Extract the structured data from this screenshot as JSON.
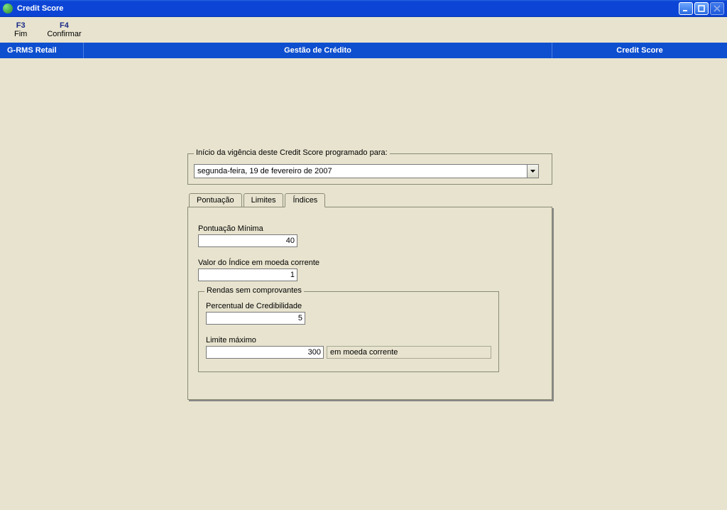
{
  "window": {
    "title": "Credit Score"
  },
  "fnbar": {
    "f3_key": "F3",
    "f3_label": "Fim",
    "f4_key": "F4",
    "f4_label": "Confirmar"
  },
  "modulebar": {
    "left": "G-RMS Retail",
    "mid": "Gestão de Crédito",
    "right": "Credit Score"
  },
  "date_group": {
    "legend": "Início da vigência deste Credit Score programado para:",
    "value": "segunda-feira, 19 de  fevereiro  de 2007"
  },
  "tabs": {
    "pontuacao": "Pontuação",
    "limites": "Limites",
    "indices": "Índices"
  },
  "indices": {
    "pont_min_label": "Pontuação Mínima",
    "pont_min_value": "40",
    "valor_indice_label": "Valor do Índice em moeda corrente",
    "valor_indice_value": "1",
    "rendas_legend": "Rendas sem comprovantes",
    "cred_label": "Percentual de Credibilidade",
    "cred_value": "5",
    "lim_label": "Limite máximo",
    "lim_value": "300",
    "lim_suffix": "em moeda corrente"
  }
}
